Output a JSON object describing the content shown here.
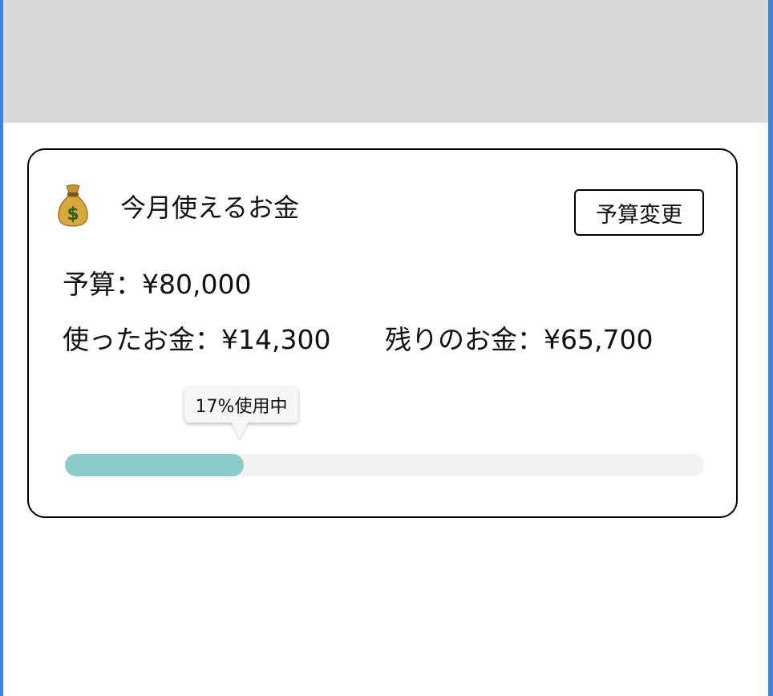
{
  "budget_card": {
    "title": "今月使えるお金",
    "edit_button_label": "予算変更",
    "budget_text": "予算：¥80,000",
    "spent_text": "使ったお金：¥14,300",
    "remaining_text": "残りのお金：¥65,700",
    "usage_tooltip": "17%使用中",
    "usage_percent": 17,
    "icon": "money-bag-icon"
  },
  "colors": {
    "header_band": "#d9d9d9",
    "progress_fill": "#8ccbca",
    "progress_track": "#f3f3f3",
    "frame_edge": "#3d85d8"
  }
}
